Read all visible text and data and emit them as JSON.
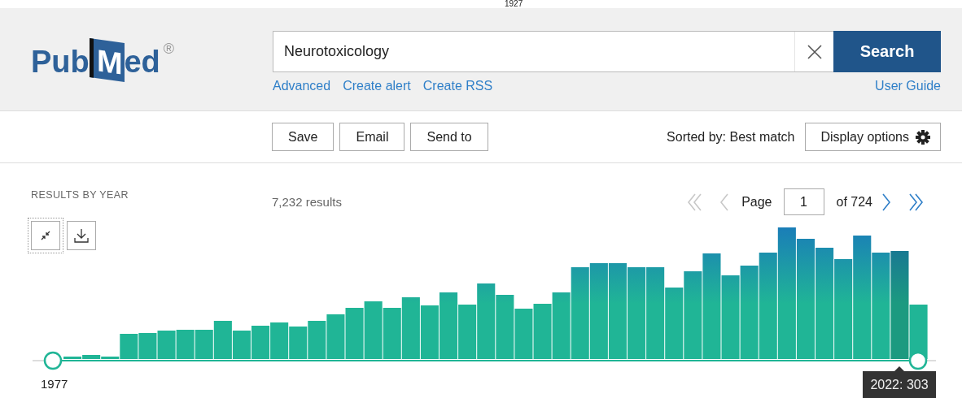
{
  "top_cut_label": "1927",
  "header": {
    "logo": {
      "part_left": "Pub",
      "part_book": "M",
      "part_right": "ed",
      "registered": "®"
    },
    "search": {
      "value": "Neurotoxicology",
      "button": "Search"
    },
    "links": [
      "Advanced",
      "Create alert",
      "Create RSS"
    ],
    "user_guide": "User Guide"
  },
  "actions": {
    "buttons": [
      "Save",
      "Email",
      "Send to"
    ],
    "sort_label": "Sorted by: Best match",
    "display_options": "Display options"
  },
  "results": {
    "heading": "RESULTS BY YEAR",
    "count": "7,232 results",
    "pagination": {
      "first_disabled": true,
      "prev_disabled": true,
      "label": "Page",
      "page": "1",
      "of": "of 724",
      "next_disabled": false,
      "last_disabled": false
    },
    "timeline": {
      "start_year": "1977",
      "tooltip": "2022: 303"
    }
  }
}
